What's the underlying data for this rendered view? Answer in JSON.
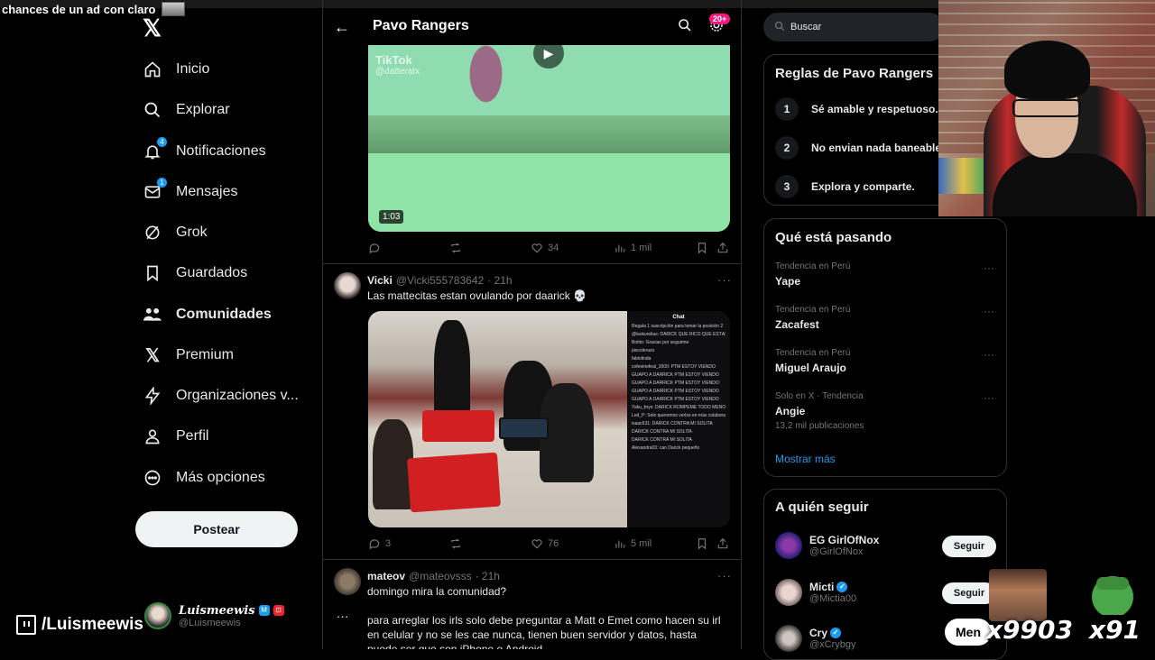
{
  "overlay": {
    "top_text": "chances de un ad con claro"
  },
  "nav": {
    "items": [
      {
        "label": "Inicio",
        "icon": "home-icon"
      },
      {
        "label": "Explorar",
        "icon": "search-icon"
      },
      {
        "label": "Notificaciones",
        "icon": "bell-icon",
        "badge": "4"
      },
      {
        "label": "Mensajes",
        "icon": "mail-icon",
        "badge": "1"
      },
      {
        "label": "Grok",
        "icon": "grok-icon"
      },
      {
        "label": "Guardados",
        "icon": "bookmark-icon"
      },
      {
        "label": "Comunidades",
        "icon": "people-icon"
      },
      {
        "label": "Premium",
        "icon": "x-logo-icon"
      },
      {
        "label": "Organizaciones v...",
        "icon": "lightning-icon"
      },
      {
        "label": "Perfil",
        "icon": "person-icon"
      },
      {
        "label": "Más opciones",
        "icon": "more-circle-icon"
      }
    ],
    "post_label": "Postear"
  },
  "user": {
    "name": "Luismeewis",
    "handle": "@Luismeewis"
  },
  "twitch": {
    "channel": "/Luismeewis"
  },
  "community": {
    "title": "Pavo Rangers",
    "notif_badge": "20+"
  },
  "video": {
    "watermark": "TikTok",
    "watermark_handle": "@datteratx",
    "duration": "1:03"
  },
  "tweet1_actions": {
    "replies": "",
    "retweets": "",
    "likes": "34",
    "views": "1 mil"
  },
  "tweet2": {
    "name": "Vicki",
    "handle": "@Vicki555783642",
    "time": "· 21h",
    "text": "Las mattecitas estan ovulando por daarick 💀",
    "chat_title": "Chat",
    "chat_lines": [
      "Regala 1 suscripción para tomar la posición 2",
      "@laskurelias: DARICK QUE RICO QUE ESTÁS",
      "Botito: Gracias por seguirme",
      "piscolerazo",
      "fabiolinda",
      "cofeeinefeal_2000: PTM ESTOY VIENDO",
      "GUAPO A DARRICK PTM ESTOY VIENDO",
      "GUAPO A DARRICK PTM ESTOY VIENDO",
      "GUAPO A DARRICK PTM ESTOY VIENDO",
      "GUAPO A DARRICK PTM ESTOY VIENDO",
      "Yaku_brys: DARICK ROMPEME TODO MENOS EL CORAZÓN",
      "Lod_P: Solo queremos verlos en más colaboraciones",
      "isaac631: DARICK CONTRA MI SOLITA",
      "DARICK CONTRA MI SOLITA",
      "DARICK CONTRA MI SOLITA",
      "Alexandra03: can Darick pequeño"
    ]
  },
  "tweet2_actions": {
    "replies": "3",
    "retweets": "",
    "likes": "76",
    "views": "5 mil"
  },
  "tweet3": {
    "name": "mateov",
    "handle": "@mateovsss",
    "time": "· 21h",
    "line1": "domingo mira la comunidad?",
    "line2": "para arreglar los irls solo debe preguntar a Matt o Emet como hacen su irl en celular y no se les cae nunca, tienen buen servidor y datos, hasta puede ser que son iPhone o Android"
  },
  "search": {
    "placeholder": "Buscar"
  },
  "rules": {
    "title": "Reglas de Pavo Rangers",
    "items": [
      {
        "num": "1",
        "text": "Sé amable y respetuoso."
      },
      {
        "num": "2",
        "text": "No envian nada baneable."
      },
      {
        "num": "3",
        "text": "Explora y comparte."
      }
    ]
  },
  "trends": {
    "title": "Qué está pasando",
    "items": [
      {
        "meta": "Tendencia en Perú",
        "name": "Yape",
        "extra": ""
      },
      {
        "meta": "Tendencia en Perú",
        "name": "Zacafest",
        "extra": ""
      },
      {
        "meta": "Tendencia en Perú",
        "name": "Miguel Araujo",
        "extra": ""
      },
      {
        "meta": "Solo en X · Tendencia",
        "name": "Angie",
        "extra": "13,2 mil publicaciones"
      }
    ],
    "show_more": "Mostrar más"
  },
  "who_to_follow": {
    "title": "A quién seguir",
    "follow_label": "Seguir",
    "items": [
      {
        "name": "EG GirlOfNox",
        "handle": "@GirlOfNox",
        "verified": false
      },
      {
        "name": "Micti",
        "handle": "@Mictia00",
        "verified": true
      },
      {
        "name": "Cry",
        "handle": "@xCrybgy",
        "verified": true
      }
    ]
  },
  "stream_overlay": {
    "men_label": "Men",
    "counter1": "x9903",
    "counter2": "x91"
  },
  "colors": {
    "accent": "#1d9bf0",
    "badge": "#f91880",
    "background": "#000000",
    "border": "#2f3336"
  }
}
